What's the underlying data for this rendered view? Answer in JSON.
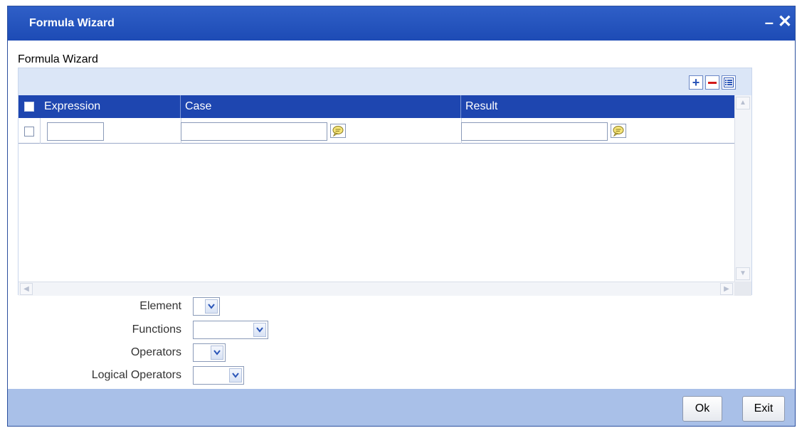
{
  "window": {
    "title": "Formula Wizard",
    "minimize_glyph": "–",
    "close_glyph": "✕"
  },
  "section_label": "Formula Wizard",
  "grid": {
    "toolbar": {
      "add_glyph": "+",
      "delete_glyph": "—",
      "view_icon": "list-view-icon"
    },
    "columns": [
      "Expression",
      "Case",
      "Result"
    ],
    "rows": [
      {
        "expression": "",
        "case": "",
        "result": ""
      }
    ],
    "scroll_arrows": {
      "up": "▲",
      "down": "▼",
      "left": "◀",
      "right": "▶"
    }
  },
  "form": {
    "element_label": "Element",
    "functions_label": "Functions",
    "operators_label": "Operators",
    "logical_operators_label": "Logical Operators",
    "element_value": "",
    "functions_value": "",
    "operators_value": "",
    "logical_operators_value": ""
  },
  "footer": {
    "ok_label": "Ok",
    "exit_label": "Exit"
  },
  "colors": {
    "titlebar": "#1d4bb5",
    "header_row": "#1e46b0",
    "footer": "#a9c0e8",
    "toolbar": "#dbe6f7"
  }
}
